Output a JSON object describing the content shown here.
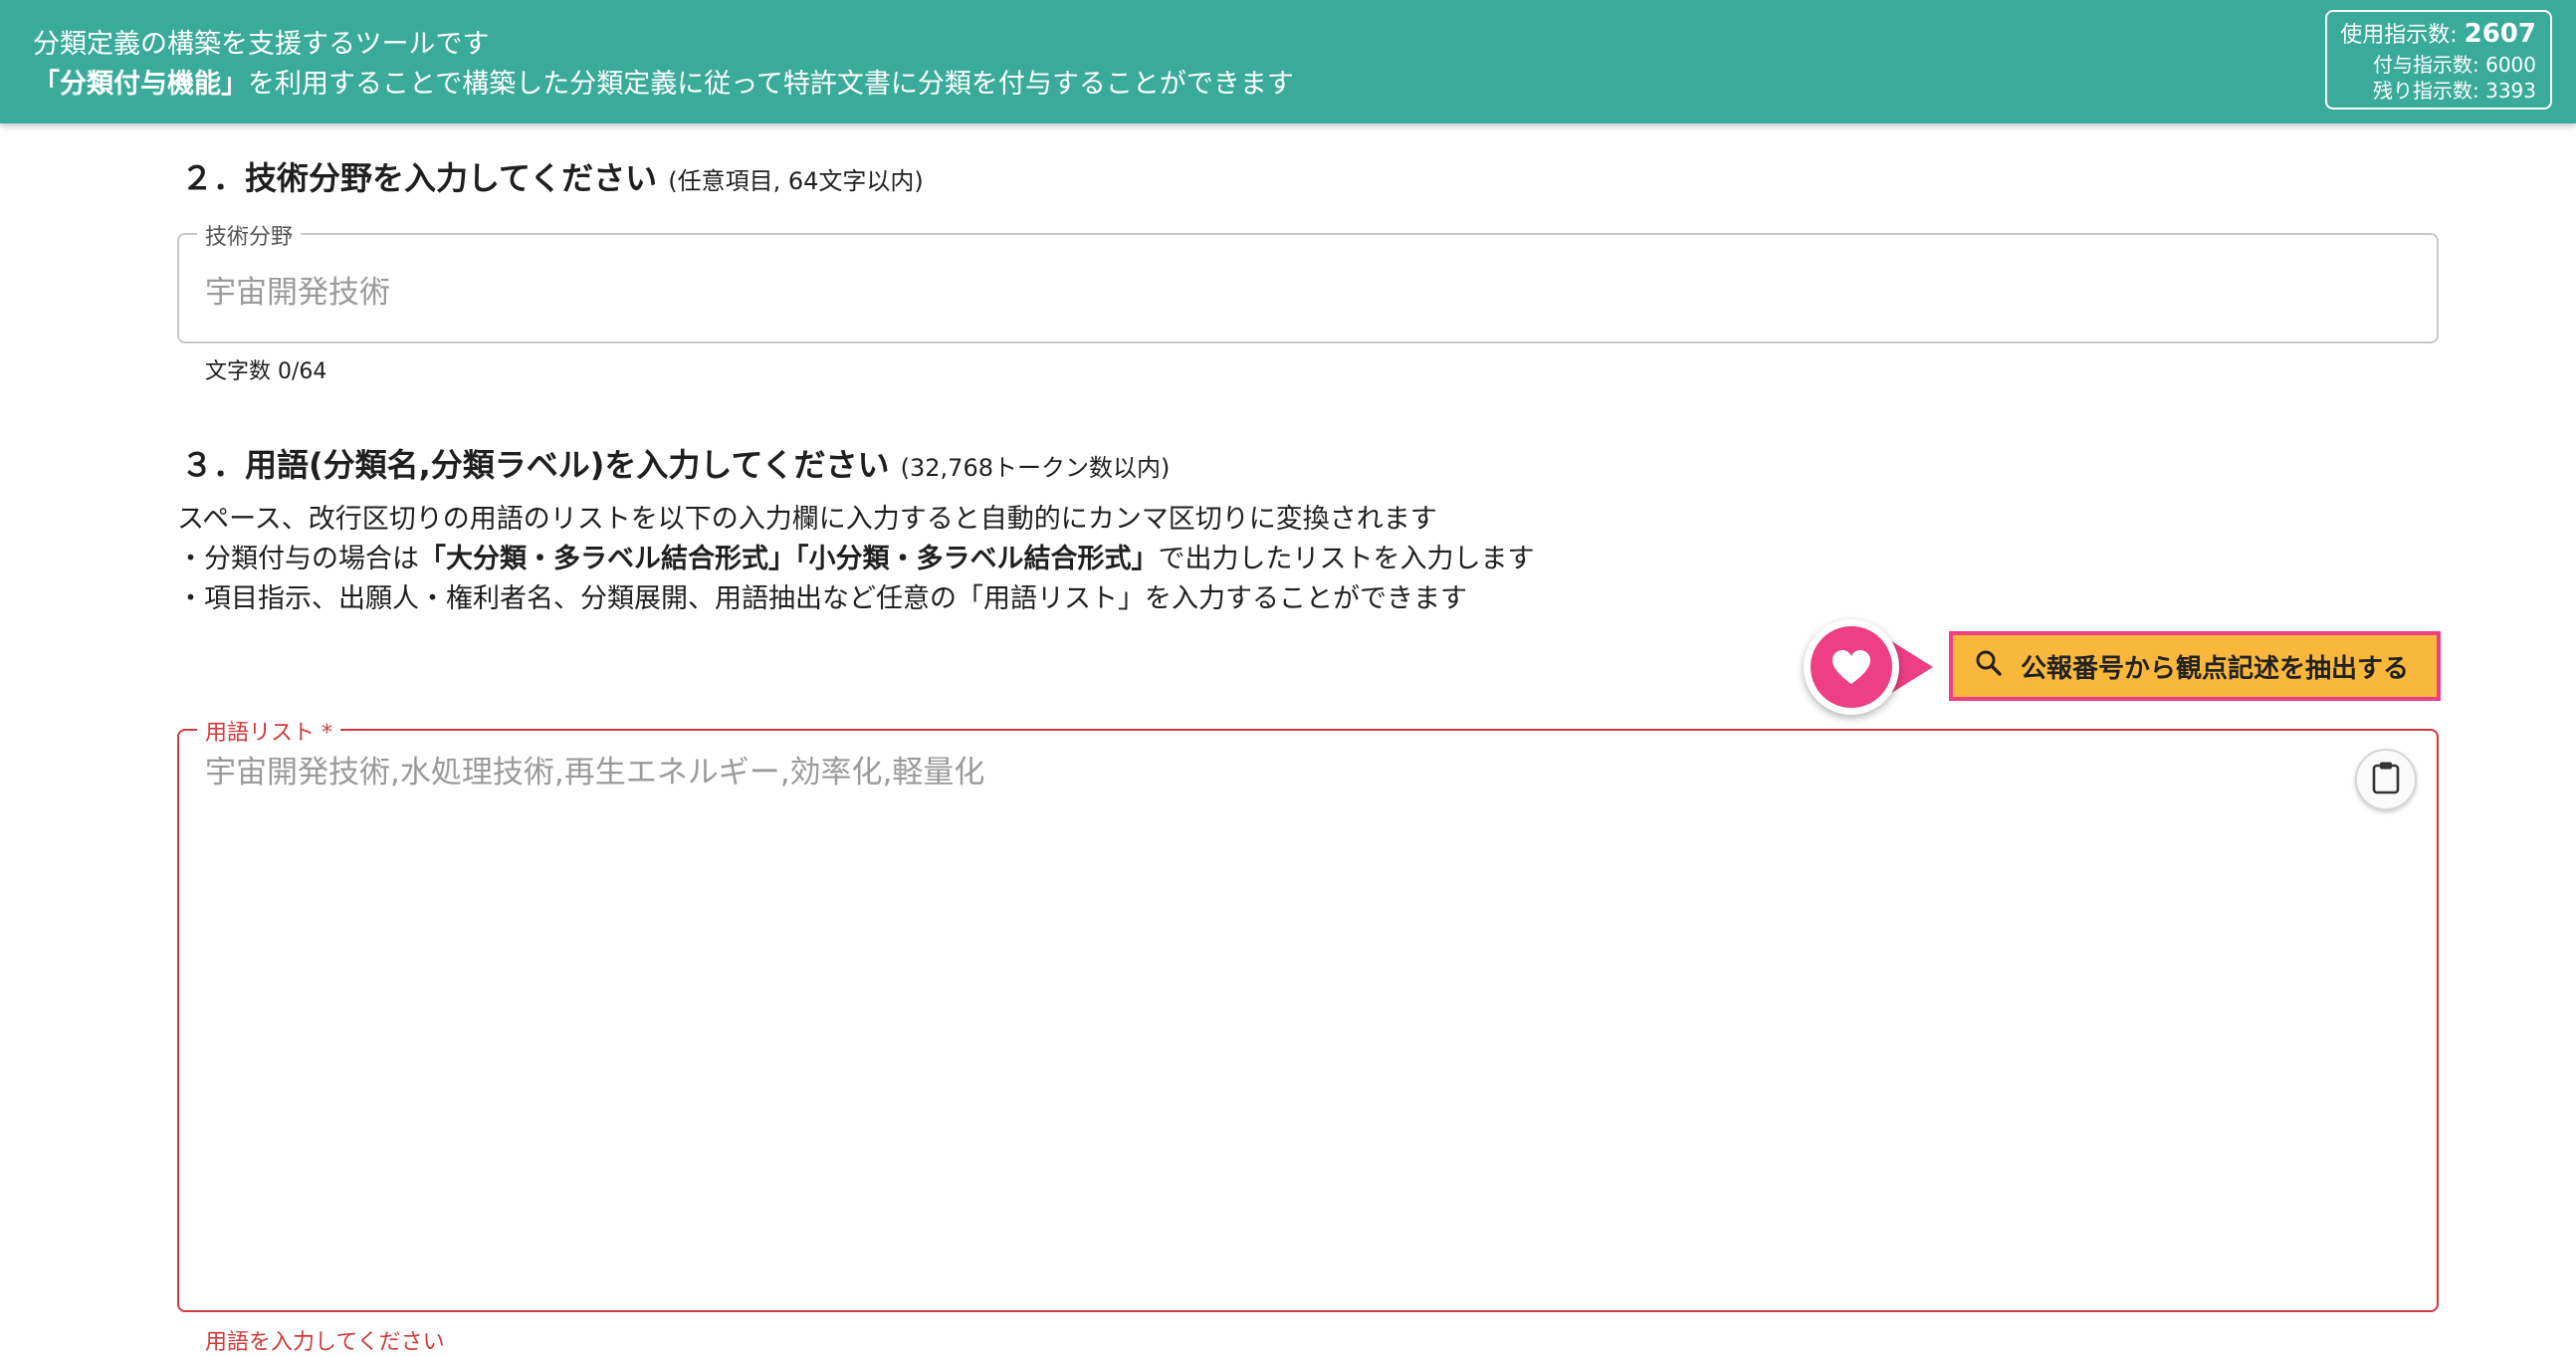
{
  "header": {
    "line1": "分類定義の構築を支援するツールです",
    "line2_bold": "「分類付与機能」",
    "line2_rest": "を利用することで構築した分類定義に従って特許文書に分類を付与することができます"
  },
  "counter": {
    "used_label": "使用指示数:",
    "used_value": "2607",
    "granted_label": "付与指示数:",
    "granted_value": "6000",
    "remaining_label": "残り指示数:",
    "remaining_value": "3393"
  },
  "section2": {
    "heading": "２．技術分野を入力してください",
    "note": "(任意項目, 64文字以内)",
    "field_label": "技術分野",
    "placeholder": "宇宙開発技術",
    "char_count": "文字数 0/64"
  },
  "section3": {
    "heading": "３．用語(分類名,分類ラベル)を入力してください",
    "note": "(32,768トークン数以内)",
    "desc_line1": "スペース、改行区切りの用語のリストを以下の入力欄に入力すると自動的にカンマ区切りに変換されます",
    "desc_line2_pre": "・分類付与の場合は",
    "desc_line2_bold": "「大分類・多ラベル結合形式」「小分類・多ラベル結合形式」",
    "desc_line2_post": "で出力したリストを入力します",
    "desc_line3": "・項目指示、出願人・権利者名、分類展開、用語抽出など任意の「用語リスト」を入力することができます",
    "extract_button": "公報番号から観点記述を抽出する",
    "field_label": "用語リスト *",
    "placeholder": "宇宙開発技術,水処理技術,再生エネルギー,効率化,軽量化",
    "error_text": "用語を入力してください"
  },
  "icons": {
    "extract": "search-icon",
    "clipboard": "clipboard-icon",
    "pointer": "heart-icon"
  },
  "colors": {
    "header_bg": "#3aab9a",
    "error": "#d03a3a",
    "highlight_border": "#ee3f84",
    "button_bg": "#f9b83c"
  }
}
